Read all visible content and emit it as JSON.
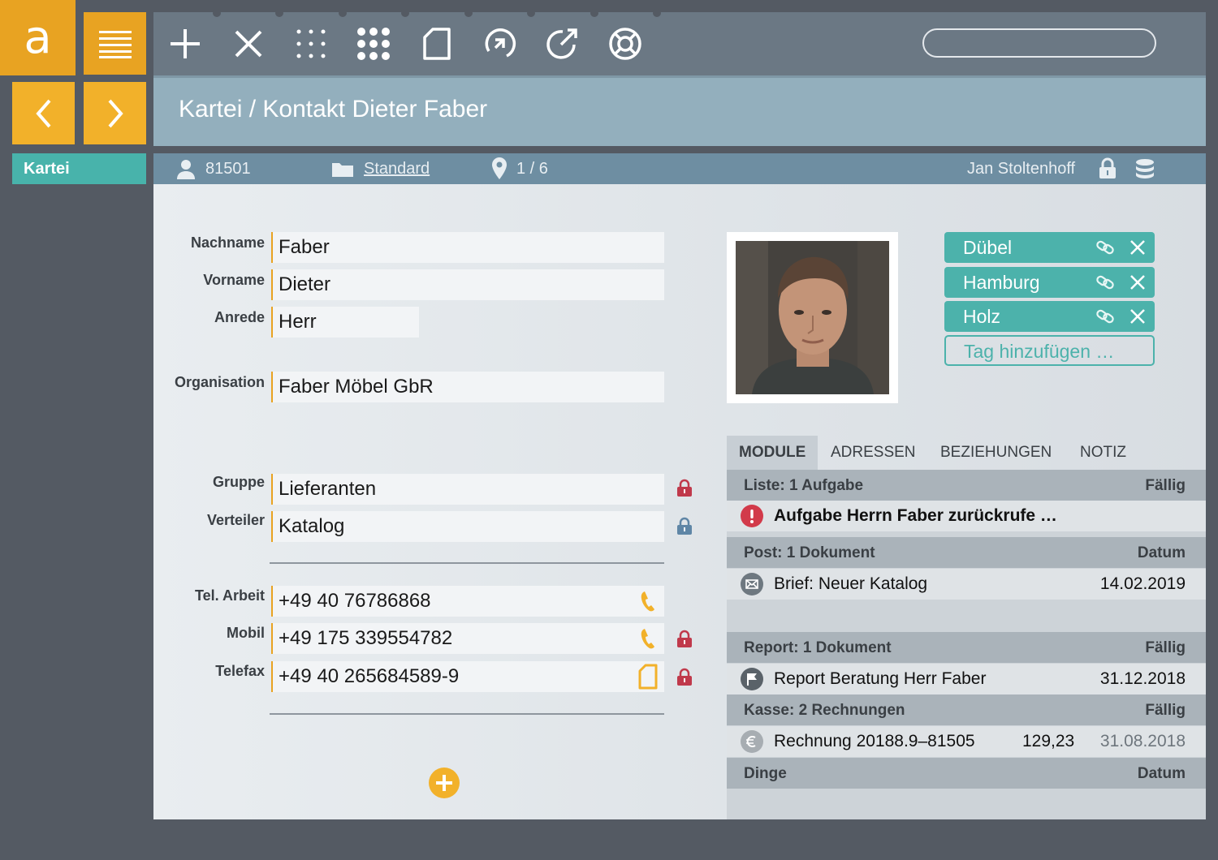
{
  "app": {
    "logo_letter": "a"
  },
  "sidebar": {
    "kartei_label": "Kartei"
  },
  "toolbar": {
    "search_placeholder": ""
  },
  "header": {
    "title": "Kartei / Kontakt Dieter Faber"
  },
  "infobar": {
    "record_id": "81501",
    "category": "Standard",
    "position": "1 / 6",
    "owner": "Jan Stoltenhoff"
  },
  "form": {
    "nachname": {
      "label": "Nachname",
      "value": "Faber"
    },
    "vorname": {
      "label": "Vorname",
      "value": "Dieter"
    },
    "anrede": {
      "label": "Anrede",
      "value": "Herr"
    },
    "organisation": {
      "label": "Organisation",
      "value": "Faber Möbel GbR"
    },
    "gruppe": {
      "label": "Gruppe",
      "value": "Lieferanten"
    },
    "verteiler": {
      "label": "Verteiler",
      "value": "Katalog"
    },
    "tel_arbeit": {
      "label": "Tel. Arbeit",
      "value": "+49 40 76786868"
    },
    "mobil": {
      "label": "Mobil",
      "value": "+49 175 339554782"
    },
    "telefax": {
      "label": "Telefax",
      "value": "+49 40 265684589-9"
    }
  },
  "tags": {
    "items": [
      {
        "label": "Dübel"
      },
      {
        "label": "Hamburg"
      },
      {
        "label": "Holz"
      }
    ],
    "add_label": "Tag hinzufügen …"
  },
  "tabs": [
    "MODULE",
    "ADRESSEN",
    "BEZIEHUNGEN",
    "NOTIZ"
  ],
  "modules": {
    "liste": {
      "title": "Liste: 1 Aufgabe",
      "col": "Fällig",
      "item": "Aufgabe Herrn Faber zurückrufe …"
    },
    "post": {
      "title": "Post: 1 Dokument",
      "col": "Datum",
      "item": "Brief: Neuer Katalog",
      "date": "14.02.2019"
    },
    "report": {
      "title": "Report: 1 Dokument",
      "col": "Fällig",
      "item": "Report Beratung Herr Faber",
      "date": "31.12.2018"
    },
    "kasse": {
      "title": "Kasse: 2 Rechnungen",
      "col": "Fällig",
      "item": "Rechnung 20188.9–81505",
      "amount": "129,23",
      "date": "31.08.2018"
    },
    "dinge": {
      "title": "Dinge",
      "col": "Datum"
    }
  },
  "colors": {
    "accent": "#e8a322",
    "teal": "#4cb2ab",
    "lock_red": "#c0394b",
    "lock_blue": "#5f86a6"
  }
}
